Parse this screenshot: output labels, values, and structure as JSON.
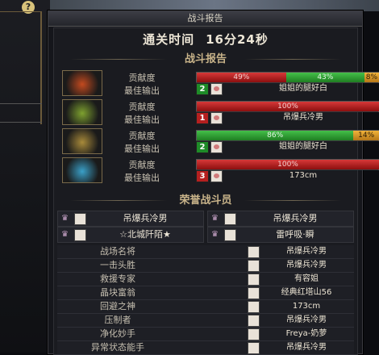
{
  "window": {
    "title": "战斗报告"
  },
  "clear_time": {
    "label": "通关时间",
    "value": "16分24秒"
  },
  "report_heading": "战斗报告",
  "honor_heading": "荣誉战斗员",
  "labels": {
    "contribution": "贡献度",
    "best_output": "最佳输出"
  },
  "players": [
    {
      "bars": [
        {
          "pct": 49,
          "text": "49%",
          "color": "red"
        },
        {
          "pct": 43,
          "text": "43%",
          "color": "green"
        },
        {
          "pct": 8,
          "text": "8%",
          "color": "orange"
        }
      ],
      "rank": "2",
      "rank_color": "green",
      "best_name": "姐姐的腿好白",
      "portrait_color": "#c34a1f"
    },
    {
      "bars": [
        {
          "pct": 100,
          "text": "100%",
          "color": "red"
        }
      ],
      "rank": "1",
      "rank_color": "red",
      "best_name": "吊爆兵冷男",
      "portrait_color": "#7ea12f"
    },
    {
      "bars": [
        {
          "pct": 86,
          "text": "86%",
          "color": "green"
        },
        {
          "pct": 14,
          "text": "14%",
          "color": "orange"
        }
      ],
      "rank": "2",
      "rank_color": "green",
      "best_name": "姐姐的腿好白",
      "portrait_color": "#a88a3a"
    },
    {
      "bars": [
        {
          "pct": 100,
          "text": "100%",
          "color": "red"
        }
      ],
      "rank": "3",
      "rank_color": "red",
      "best_name": "173cm",
      "portrait_color": "#3aa0c8"
    }
  ],
  "honor": [
    {
      "name": "吊爆兵冷男",
      "icon": "crown-icon"
    },
    {
      "name": "吊爆兵冷男",
      "icon": "crown-icon"
    },
    {
      "name": "☆北城阡陌★",
      "icon": "crown-icon"
    },
    {
      "name": "雷呼吸·瞬",
      "icon": "crown-icon"
    }
  ],
  "titles": [
    {
      "title": "战场名将",
      "name": "吊爆兵冷男"
    },
    {
      "title": "一击头胜",
      "name": "吊爆兵冷男"
    },
    {
      "title": "救援专家",
      "name": "有容姐"
    },
    {
      "title": "晶块富翁",
      "name": "经典红塔山56"
    },
    {
      "title": "回避之神",
      "name": "173cm"
    },
    {
      "title": "压制者",
      "name": "吊爆兵冷男"
    },
    {
      "title": "净化妙手",
      "name": "Freya-奶萝"
    },
    {
      "title": "异常状态能手",
      "name": "吊爆兵冷男"
    }
  ]
}
